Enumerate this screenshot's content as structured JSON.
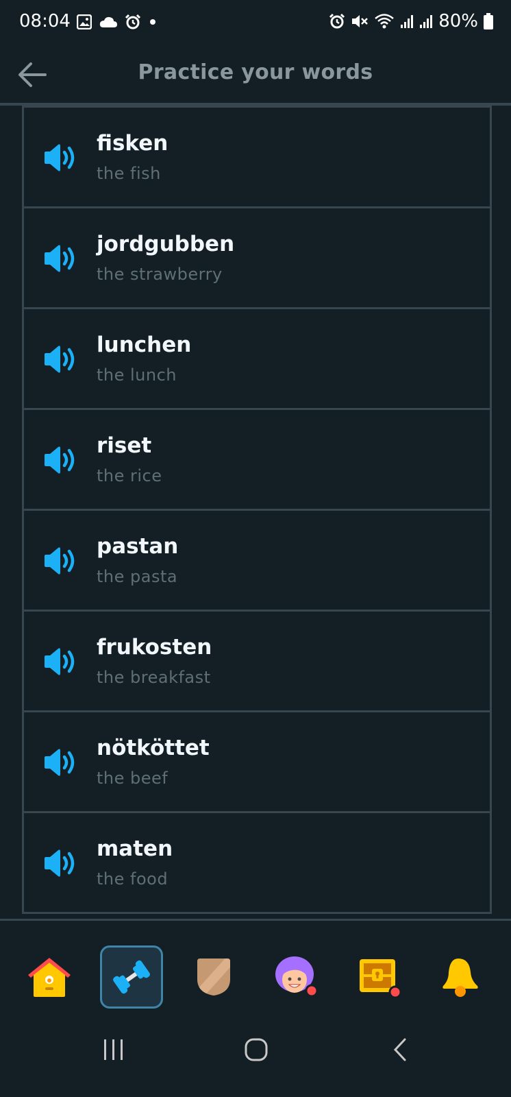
{
  "status_bar": {
    "time": "08:04",
    "battery": "80%",
    "left_icons": [
      "image-icon",
      "cloud-icon",
      "alarm-icon",
      "dot-icon"
    ],
    "right_icons": [
      "alarm-icon",
      "mute-icon",
      "wifi-icon",
      "signal-icon",
      "signal-icon",
      "battery-icon"
    ]
  },
  "header": {
    "title": "Practice your words",
    "back_icon": "arrow-left-icon"
  },
  "words": [
    {
      "word": "fisken",
      "translation": "the fish"
    },
    {
      "word": "jordgubben",
      "translation": "the strawberry"
    },
    {
      "word": "lunchen",
      "translation": "the lunch"
    },
    {
      "word": "riset",
      "translation": "the rice"
    },
    {
      "word": "pastan",
      "translation": "the pasta"
    },
    {
      "word": "frukosten",
      "translation": "the breakfast"
    },
    {
      "word": "nötköttet",
      "translation": "the beef"
    },
    {
      "word": "maten",
      "translation": "the food"
    }
  ],
  "bottom_nav": [
    {
      "name": "home",
      "icon": "home-icon",
      "active": false
    },
    {
      "name": "practice",
      "icon": "dumbbell-icon",
      "active": true
    },
    {
      "name": "leagues",
      "icon": "shield-icon",
      "active": false
    },
    {
      "name": "profile",
      "icon": "avatar-icon",
      "active": false
    },
    {
      "name": "shop",
      "icon": "treasure-chest-icon",
      "active": false
    },
    {
      "name": "notifications",
      "icon": "bell-icon",
      "active": false
    }
  ],
  "system_nav": [
    "recent-apps-icon",
    "home-circle-icon",
    "back-chevron-icon"
  ],
  "colors": {
    "background": "#131f24",
    "border": "#37464f",
    "speaker": "#1cb0f6",
    "word": "#f1f7fb",
    "translation": "#5f6f76",
    "title": "#8a979c"
  }
}
